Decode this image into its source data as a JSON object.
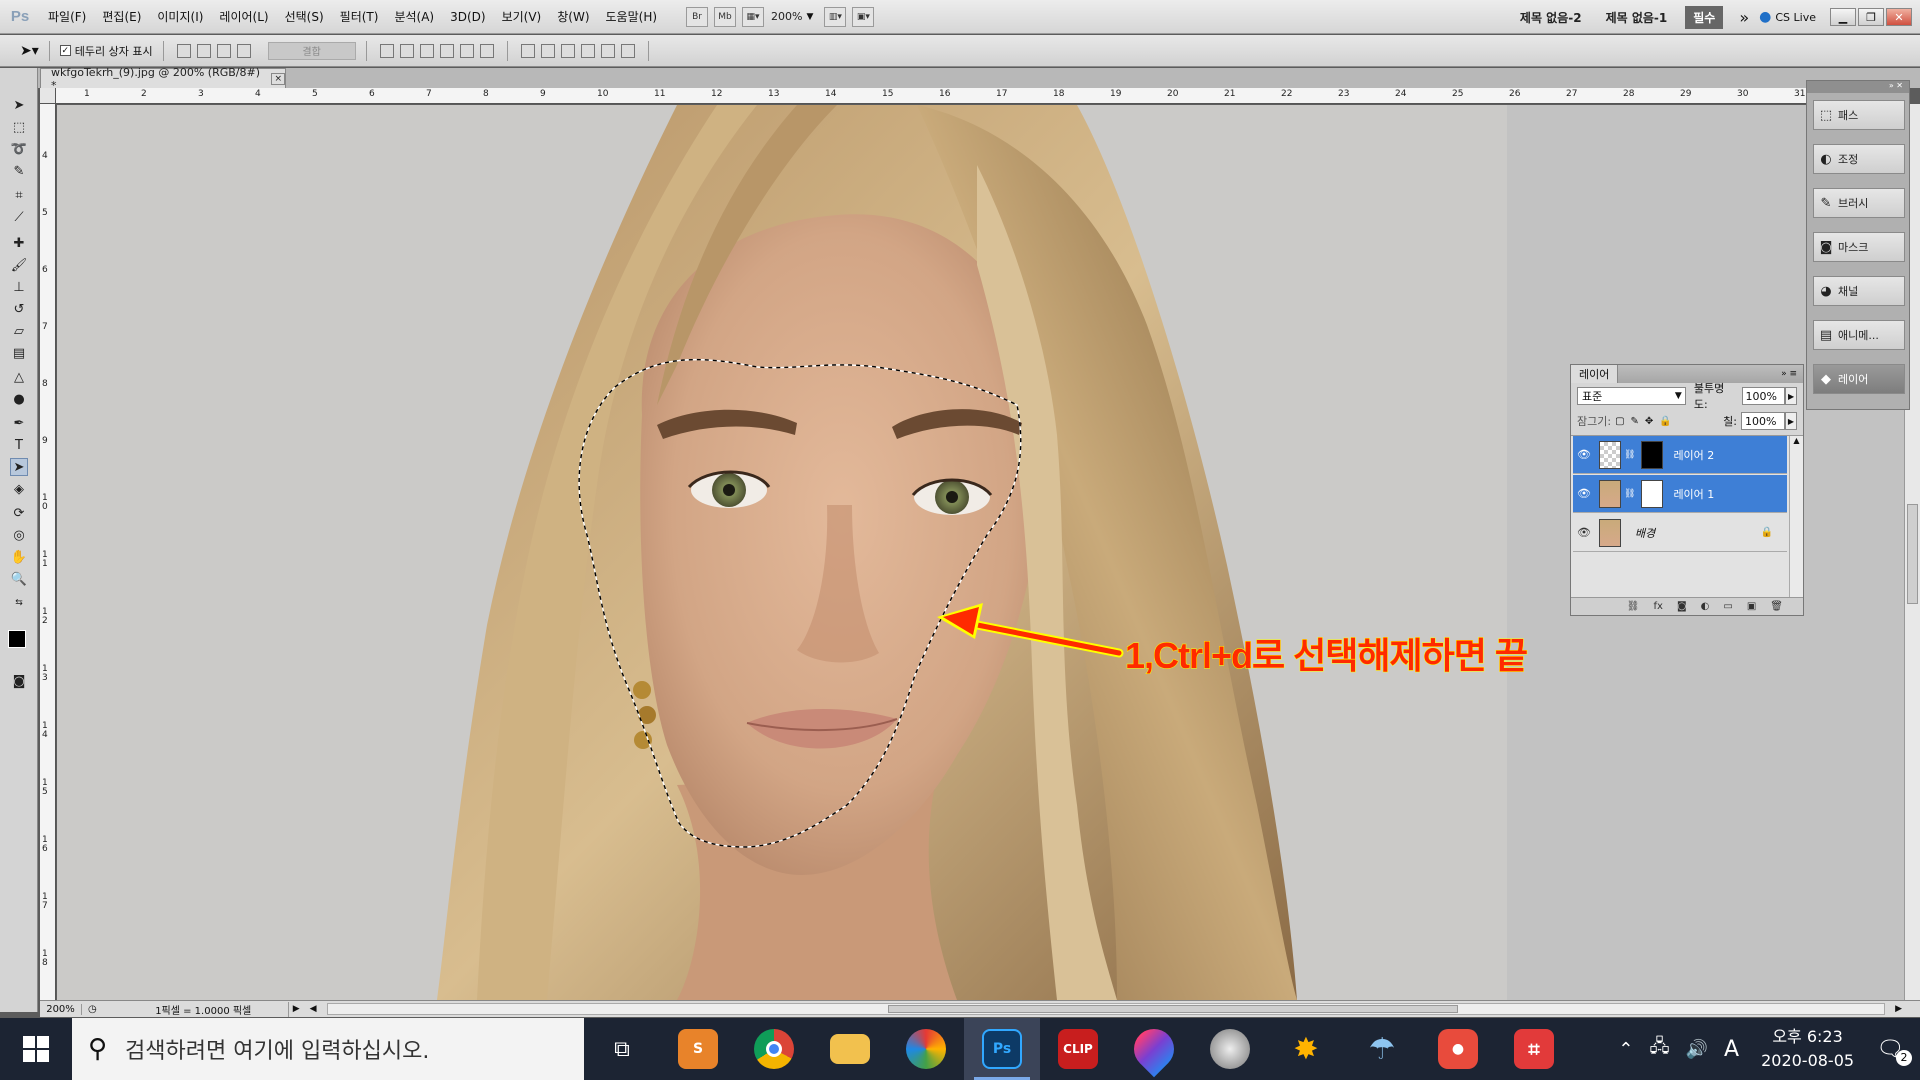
{
  "app": {
    "logo": "Ps",
    "document_tab": "wkfgoTekrh_(9).jpg @ 200% (RGB/8#) *",
    "close_glyph": "×"
  },
  "menubar": {
    "items": [
      "파일(F)",
      "편집(E)",
      "이미지(I)",
      "레이어(L)",
      "선택(S)",
      "필터(T)",
      "분석(A)",
      "3D(D)",
      "보기(V)",
      "창(W)",
      "도움말(H)"
    ],
    "icons": [
      "Br",
      "Mb"
    ],
    "zoom": "200%",
    "workspaces": [
      "제목 없음-2",
      "제목 없음-1"
    ],
    "active_workspace": "필수",
    "more": "»",
    "cs_live": "CS Live"
  },
  "options": {
    "show_bounding_box": "테두리 상자 표시",
    "combine_label": "결합"
  },
  "ruler": {
    "top": [
      "1",
      "2",
      "3",
      "4",
      "5",
      "6",
      "7",
      "8",
      "9",
      "10",
      "11",
      "12",
      "13",
      "14",
      "15",
      "16",
      "17",
      "18",
      "19",
      "20",
      "21",
      "22",
      "23",
      "24",
      "25",
      "26",
      "27",
      "28",
      "29",
      "30",
      "31"
    ],
    "left": [
      "4",
      "5",
      "6",
      "7",
      "8",
      "9",
      "1\n0",
      "1\n1",
      "1\n2",
      "1\n3",
      "1\n4",
      "1\n5",
      "1\n6",
      "1\n7",
      "1\n8"
    ]
  },
  "annotation": {
    "text": "1,Ctrl+d로 선택해제하면 끝",
    "color": "#ff2a00",
    "arrow_color": "#ff2a00",
    "outline_color": "#ffff00"
  },
  "status": {
    "zoom": "200%",
    "info": "1픽셀 = 1.0000 픽셀"
  },
  "dock": {
    "items": [
      {
        "label": "패스",
        "icon": "path-icon"
      },
      {
        "label": "조정",
        "icon": "adjust-icon"
      },
      {
        "label": "브러시",
        "icon": "brush-icon"
      },
      {
        "label": "마스크",
        "icon": "mask-icon"
      },
      {
        "label": "채널",
        "icon": "channel-icon"
      },
      {
        "label": "애니메...",
        "icon": "animation-icon"
      },
      {
        "label": "레이어",
        "icon": "layers-icon"
      }
    ]
  },
  "layers_panel": {
    "tab": "레이어",
    "blend_mode": "표준",
    "opacity_label": "불투명도:",
    "opacity": "100%",
    "lock_label": "잠그기:",
    "fill_label": "칠:",
    "fill": "100%",
    "layers": [
      {
        "name": "레이어 2",
        "selected": true
      },
      {
        "name": "레이어 1",
        "selected": true
      },
      {
        "name": "배경",
        "selected": false
      }
    ]
  },
  "taskbar": {
    "search_placeholder": "검색하려면 여기에 입력하십시오.",
    "apps": [
      {
        "name": "task-view",
        "label": ""
      },
      {
        "name": "sublime-app",
        "label": "S",
        "color": "#e8832a"
      },
      {
        "name": "chrome-app",
        "label": "",
        "color": "#db4437"
      },
      {
        "name": "explorer-app",
        "label": "",
        "color": "#f2c14e"
      },
      {
        "name": "photoscape-app",
        "label": "",
        "color": "#444444"
      },
      {
        "name": "photoshop-app",
        "label": "Ps",
        "color": "#0d3a66"
      },
      {
        "name": "clip-app",
        "label": "CLIP",
        "color": "#c81e1e"
      },
      {
        "name": "paint-drop-app",
        "label": "",
        "color": "#7a3fd1"
      },
      {
        "name": "pro-app",
        "label": "",
        "color": "#888888"
      },
      {
        "name": "burst-app",
        "label": "",
        "color": "#d28c10"
      },
      {
        "name": "parachute-app",
        "label": "",
        "color": "#5aa0d6"
      },
      {
        "name": "bandicam-app",
        "label": "",
        "color": "#e84b3c"
      },
      {
        "name": "crop-pro-app",
        "label": "",
        "color": "#e23a3a"
      }
    ],
    "time": "오후 6:23",
    "date": "2020-08-05",
    "ime": "A",
    "notif_count": "2"
  }
}
